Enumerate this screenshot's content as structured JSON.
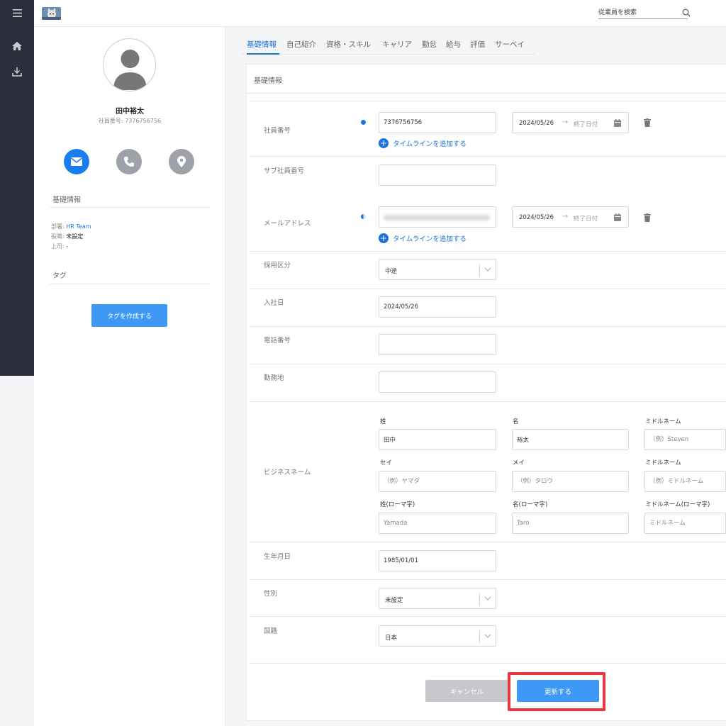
{
  "search": {
    "placeholder": "従業員を検索"
  },
  "profile": {
    "name": "田中裕太",
    "employee_id": "社員番号: 7376756756",
    "basic_info_title": "基礎情報",
    "dept_label": "部署: ",
    "dept_value": "HR Team",
    "role_label": "役職: ",
    "role_value": "未設定",
    "boss_label": "上司: ",
    "boss_value": "-",
    "tag_title": "タグ",
    "tag_button": "タグを作成する"
  },
  "tabs": [
    "基礎情報",
    "自己紹介",
    "資格・スキル",
    "キャリア",
    "勤怠",
    "給与",
    "評価",
    "サーベイ"
  ],
  "card": {
    "title": "基礎情報"
  },
  "form": {
    "employee_no": {
      "label": "社員番号",
      "value": "7376756756",
      "start": "2024/05/26",
      "end": "終了日付"
    },
    "add_timeline": "タイムラインを追加する",
    "sub_employee_no": {
      "label": "サブ社員番号",
      "value": ""
    },
    "email": {
      "label": "メールアドレス",
      "start": "2024/05/26",
      "end": "終了日付"
    },
    "hire_type": {
      "label": "採用区分",
      "value": "中途"
    },
    "join_date": {
      "label": "入社日",
      "value": "2024/05/26"
    },
    "phone": {
      "label": "電話番号",
      "value": ""
    },
    "workplace": {
      "label": "勤務地",
      "value": ""
    },
    "business_name": {
      "label": "ビジネスネーム",
      "last": {
        "label": "姓",
        "value": "田中"
      },
      "first": {
        "label": "名",
        "value": "裕太"
      },
      "middle": {
        "label": "ミドルネーム",
        "placeholder": "（例）Steven"
      },
      "last_kana": {
        "label": "セイ",
        "placeholder": "（例）ヤマダ"
      },
      "first_kana": {
        "label": "メイ",
        "placeholder": "（例）タロウ"
      },
      "middle_kana": {
        "label": "ミドルネーム",
        "placeholder": "（例）ミドルネーム"
      },
      "last_roman": {
        "label": "姓(ローマ字)",
        "placeholder": "Yamada"
      },
      "first_roman": {
        "label": "名(ローマ字)",
        "placeholder": "Taro"
      },
      "middle_roman": {
        "label": "ミドルネーム(ローマ字)",
        "placeholder": "ミドルネーム"
      }
    },
    "birthday": {
      "label": "生年月日",
      "value": "1985/01/01"
    },
    "gender": {
      "label": "性別",
      "value": "未設定"
    },
    "nationality": {
      "label": "国籍",
      "value": "日本"
    }
  },
  "actions": {
    "cancel": "キャンセル",
    "update": "更新する"
  },
  "colors": {
    "accent": "#3d99f5",
    "link": "#1a73d9",
    "nav": "#2b2f3c",
    "highlight": "#e8353f"
  }
}
